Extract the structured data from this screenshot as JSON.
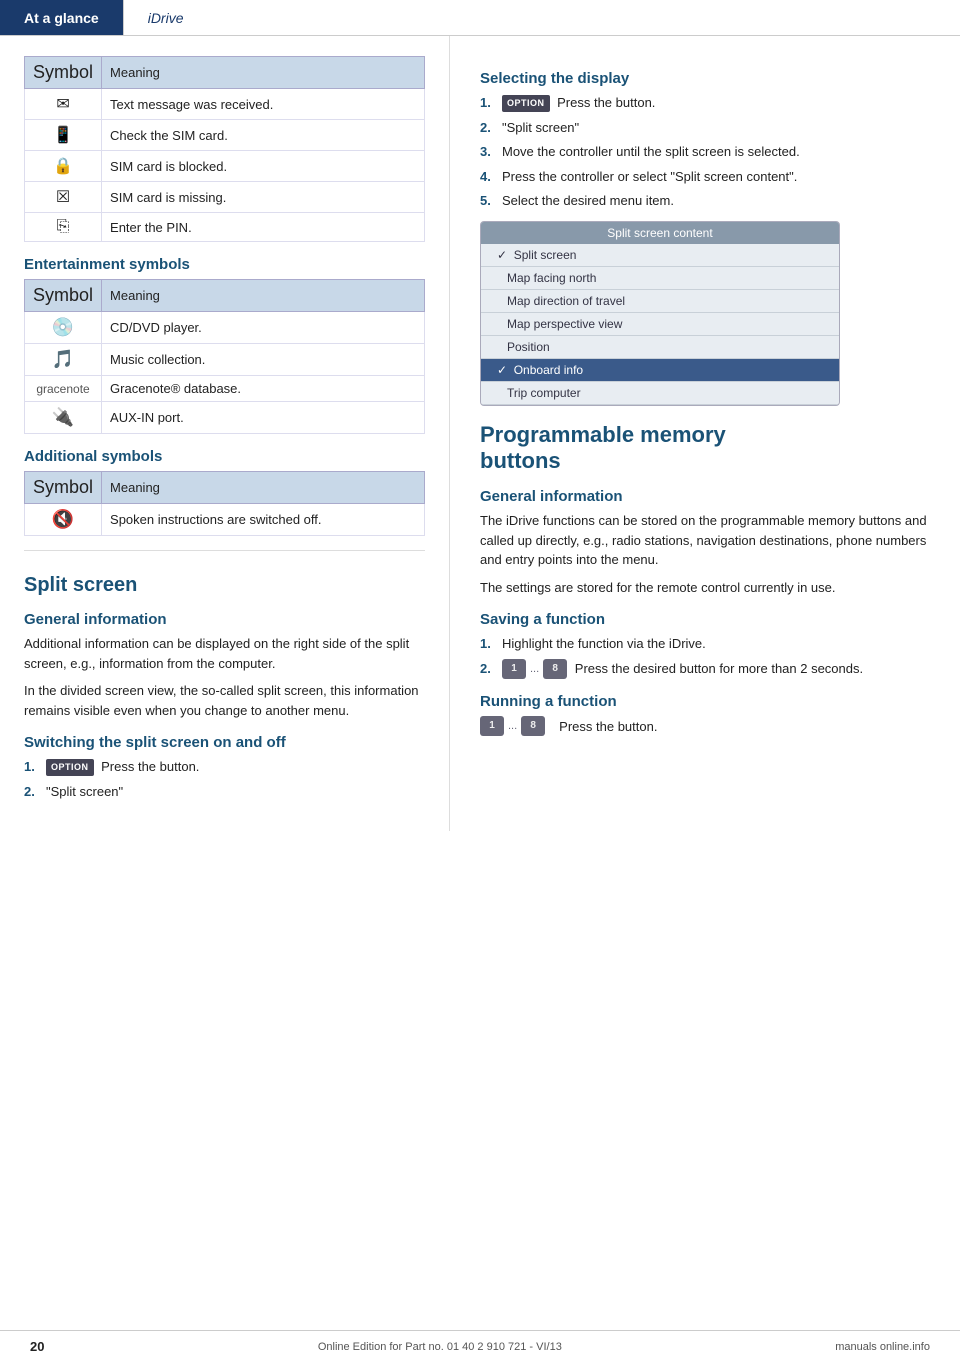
{
  "header": {
    "tab_active": "At a glance",
    "tab_inactive": "iDrive"
  },
  "left_col": {
    "tables": {
      "symbols_header": [
        "Symbol",
        "Meaning"
      ],
      "symbols_rows": [
        {
          "symbol": "✉",
          "meaning": "Text message was received."
        },
        {
          "symbol": "⬛",
          "meaning": "Check the SIM card."
        },
        {
          "symbol": "⬛",
          "meaning": "SIM card is blocked."
        },
        {
          "symbol": "⬛",
          "meaning": "SIM card is missing."
        },
        {
          "symbol": "⬛",
          "meaning": "Enter the PIN."
        }
      ],
      "entertainment_heading": "Entertainment symbols",
      "entertainment_header": [
        "Symbol",
        "Meaning"
      ],
      "entertainment_rows": [
        {
          "symbol": "⊙",
          "meaning": "CD/DVD player."
        },
        {
          "symbol": "⊟",
          "meaning": "Music collection."
        },
        {
          "symbol": "●",
          "meaning": "Gracenote® database."
        },
        {
          "symbol": "✎",
          "meaning": "AUX-IN port."
        }
      ],
      "additional_heading": "Additional symbols",
      "additional_header": [
        "Symbol",
        "Meaning"
      ],
      "additional_rows": [
        {
          "symbol": "⬛",
          "meaning": "Spoken instructions are switched off."
        }
      ]
    },
    "split_screen": {
      "heading": "Split screen",
      "general_info_heading": "General information",
      "general_info_text1": "Additional information can be displayed on the right side of the split screen, e.g., information from the computer.",
      "general_info_text2": "In the divided screen view, the so-called split screen, this information remains visible even when you change to another menu.",
      "switching_heading": "Switching the split screen on and off",
      "steps": [
        {
          "num": "1.",
          "text": "Press the button.",
          "has_btn": true
        },
        {
          "num": "2.",
          "text": "\"Split screen\""
        }
      ]
    }
  },
  "right_col": {
    "selecting_heading": "Selecting the display",
    "selecting_steps": [
      {
        "num": "1.",
        "text": "Press the button.",
        "has_btn": true
      },
      {
        "num": "2.",
        "text": "\"Split screen\""
      },
      {
        "num": "3.",
        "text": "Move the controller until the split screen is selected."
      },
      {
        "num": "4.",
        "text": "Press the controller or select \"Split screen content\"."
      },
      {
        "num": "5.",
        "text": "Select the desired menu item."
      }
    ],
    "screenshot": {
      "title": "Split screen content",
      "items": [
        {
          "label": "✓  Split screen",
          "highlighted": false
        },
        {
          "label": "Map facing north",
          "highlighted": false
        },
        {
          "label": "Map direction of travel",
          "highlighted": false
        },
        {
          "label": "Map perspective view",
          "highlighted": false
        },
        {
          "label": "Position",
          "highlighted": false
        },
        {
          "label": "✓  Onboard info",
          "highlighted": true
        },
        {
          "label": "Trip computer",
          "highlighted": false
        }
      ]
    },
    "programmable_heading": "Programmable memory buttons",
    "general_info_heading": "General information",
    "general_info_text1": "The iDrive functions can be stored on the programmable memory buttons and called up directly, e.g., radio stations, navigation destinations, phone numbers and entry points into the menu.",
    "general_info_text2": "The settings are stored for the remote control currently in use.",
    "saving_heading": "Saving a function",
    "saving_steps": [
      {
        "num": "1.",
        "text": "Highlight the function via the iDrive."
      },
      {
        "num": "2.",
        "text": "Press the desired button for more than 2 seconds.",
        "has_mem_btn": true
      }
    ],
    "running_heading": "Running a function",
    "running_text": "Press the button.",
    "running_has_mem_btn": true
  },
  "footer": {
    "page_number": "20",
    "copyright": "Online Edition for Part no. 01 40 2 910 721 - VI/13",
    "domain": "manuals online.info"
  },
  "icons": {
    "option_btn_label": "OPTION",
    "mem_btn_1": "1",
    "mem_btn_8": "8",
    "ellipsis": "...",
    "check": "✓"
  }
}
